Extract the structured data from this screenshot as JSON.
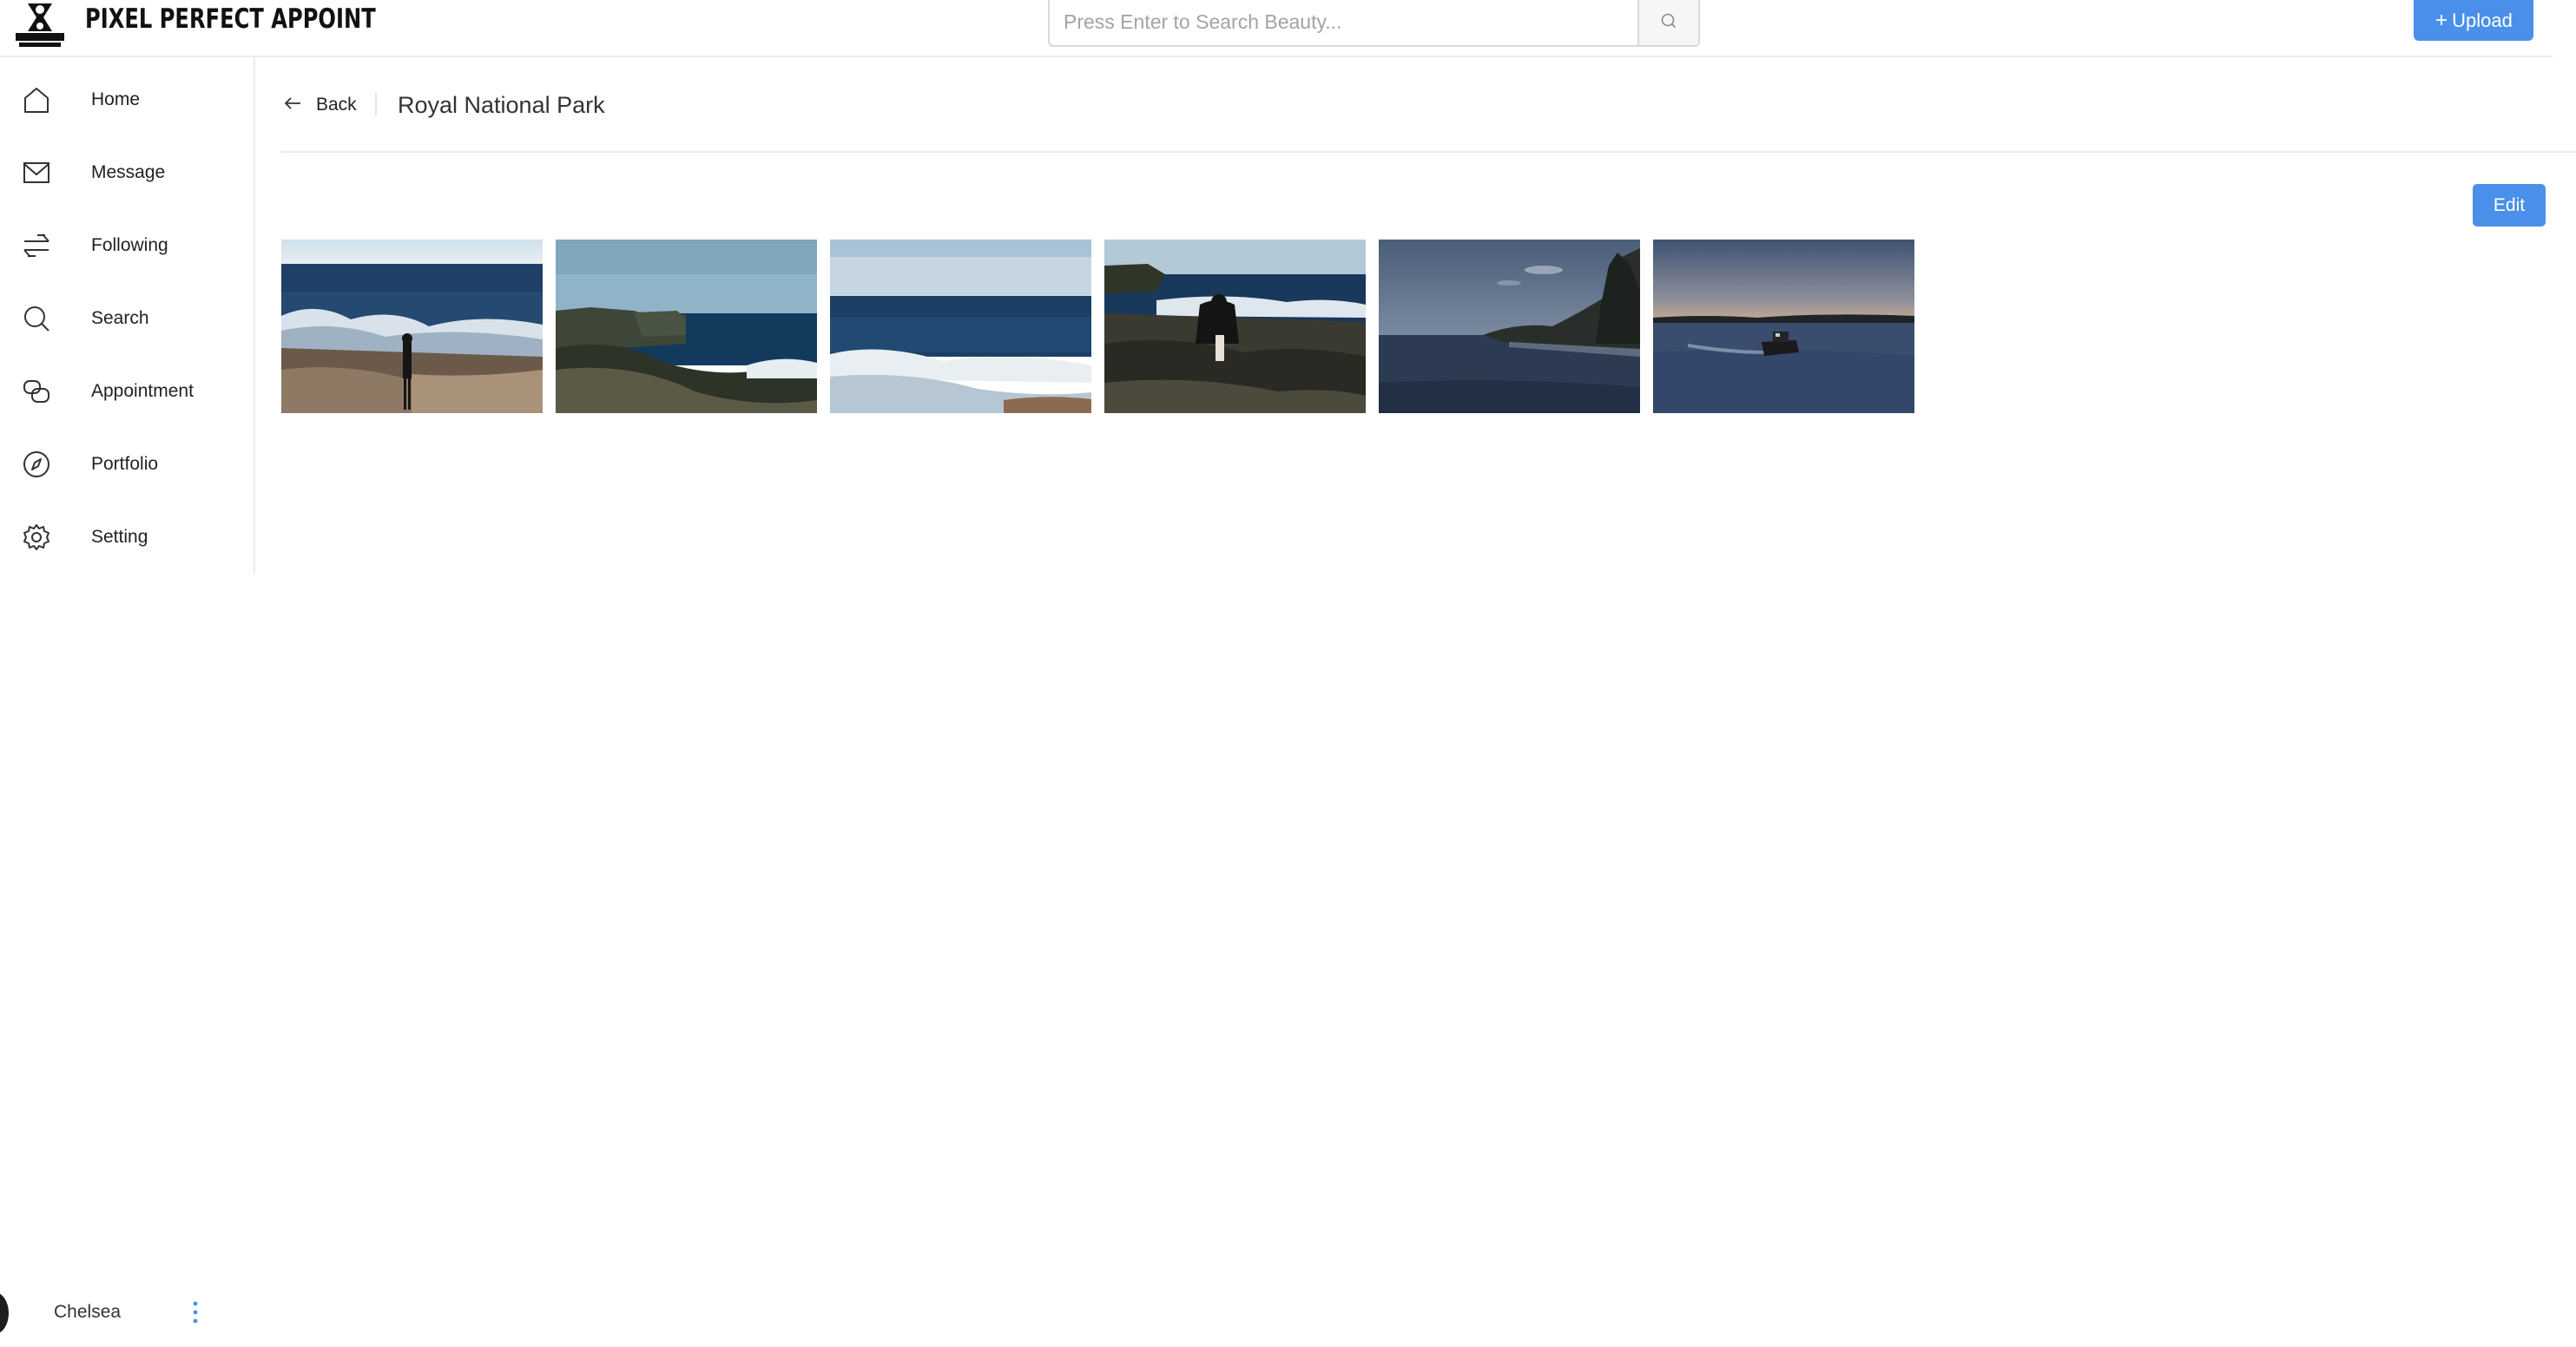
{
  "header": {
    "brand": "PIXEL PERFECT APPOINT",
    "logo_icon": "pixel-perfect-logo",
    "search": {
      "placeholder": "Press Enter to Search Beauty...",
      "value": "",
      "icon": "search-icon"
    },
    "upload": {
      "label": "Upload",
      "icon": "plus-icon"
    }
  },
  "sidebar": {
    "items": [
      {
        "label": "Home",
        "icon": "home-icon"
      },
      {
        "label": "Message",
        "icon": "mail-icon"
      },
      {
        "label": "Following",
        "icon": "following-icon"
      },
      {
        "label": "Search",
        "icon": "search-icon"
      },
      {
        "label": "Appointment",
        "icon": "appointment-icon"
      },
      {
        "label": "Portfolio",
        "icon": "compass-icon"
      },
      {
        "label": "Setting",
        "icon": "gear-icon"
      }
    ]
  },
  "user": {
    "name": "Chelsea",
    "menu_icon": "more-vertical-icon"
  },
  "main": {
    "back_label": "Back",
    "title": "Royal National Park",
    "edit_label": "Edit",
    "photos": [
      {
        "subject": "ocean-rocks-person"
      },
      {
        "subject": "coastal-cliff"
      },
      {
        "subject": "ocean-waves"
      },
      {
        "subject": "rocks-person-sitting"
      },
      {
        "subject": "bay-dusk-shoreline"
      },
      {
        "subject": "boat-dusk"
      }
    ]
  },
  "colors": {
    "accent": "#4a90ea",
    "border": "#ececec"
  }
}
